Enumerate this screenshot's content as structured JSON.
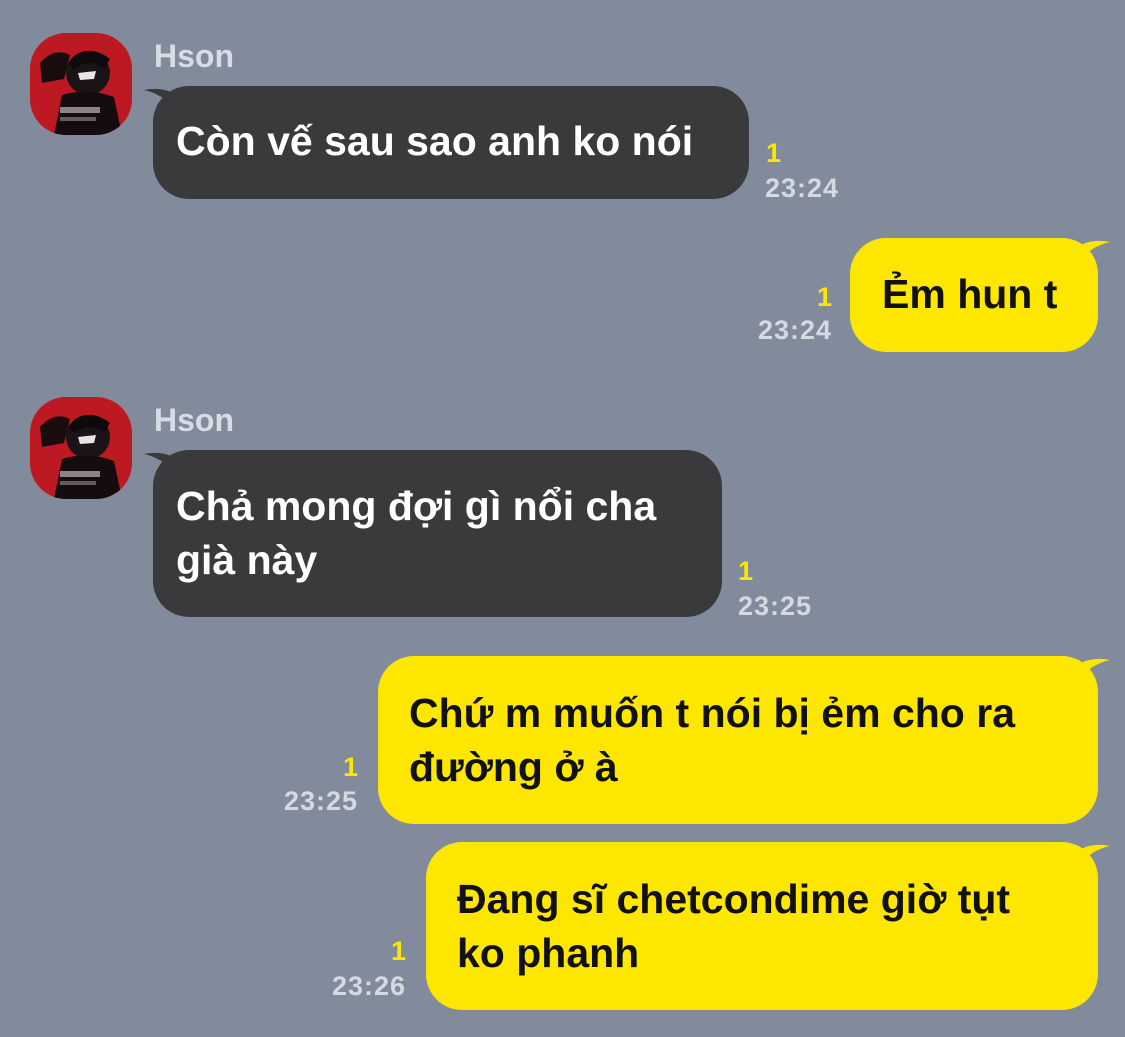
{
  "contact": {
    "name": "Hson"
  },
  "messages": [
    {
      "direction": "incoming",
      "sender": "Hson",
      "lines": [
        "Còn vế sau sao anh ko nói"
      ],
      "unread": "1",
      "time": "23:24"
    },
    {
      "direction": "outgoing",
      "lines": [
        "Ẻm hun t"
      ],
      "unread": "1",
      "time": "23:24"
    },
    {
      "direction": "incoming",
      "sender": "Hson",
      "lines": [
        "Chả mong đợi gì nổi cha",
        "già này"
      ],
      "unread": "1",
      "time": "23:25"
    },
    {
      "direction": "outgoing",
      "lines": [
        "Chứ m muốn t nói bị ẻm cho ra",
        "đường ở à"
      ],
      "unread": "1",
      "time": "23:25"
    },
    {
      "direction": "outgoing",
      "lines": [
        "Đang sĩ chetcondime giờ tụt",
        "ko phanh"
      ],
      "unread": "1",
      "time": "23:26"
    }
  ],
  "colors": {
    "background": "#818b9c",
    "incoming_bubble": "#3a3a3d",
    "outgoing_bubble": "#fde600",
    "unread_count": "#fde600",
    "timestamp": "#d5d9e1"
  }
}
